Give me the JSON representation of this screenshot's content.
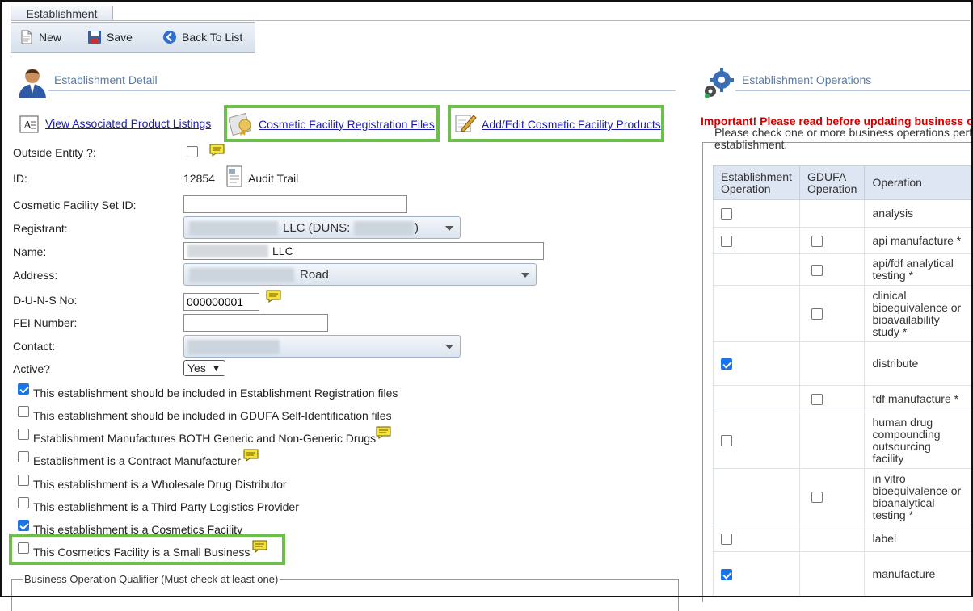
{
  "tab": {
    "label": "Establishment"
  },
  "toolbar": {
    "new_label": "New",
    "save_label": "Save",
    "back_label": "Back To List"
  },
  "detail": {
    "section_title": "Establishment Detail",
    "links": {
      "view_listings": "View Associated Product Listings",
      "registration_files": "Cosmetic Facility Registration Files",
      "add_edit_products": "Add/Edit Cosmetic Facility Products"
    },
    "fields": {
      "outside_entity_label": "Outside Entity ?:",
      "outside_entity_checked": false,
      "id_label": "ID:",
      "id_value": "12854",
      "audit_trail": "Audit Trail",
      "set_id_label": "Cosmetic Facility Set ID:",
      "set_id_value": "",
      "registrant_label": "Registrant:",
      "registrant_value_a": "LLC (DUNS:",
      "registrant_value_b": ")",
      "name_label": "Name:",
      "name_value": "LLC",
      "address_label": "Address:",
      "address_value": "Road",
      "duns_label": "D-U-N-S No:",
      "duns_value": "000000001",
      "fei_label": "FEI Number:",
      "fei_value": "",
      "contact_label": "Contact:",
      "active_label": "Active?",
      "active_value": "Yes"
    },
    "checks": [
      {
        "label": "This establishment should be included in Establishment Registration files",
        "checked": true
      },
      {
        "label": "This establishment should be included in GDUFA Self-Identification files",
        "checked": false
      },
      {
        "label": "Establishment Manufactures BOTH Generic and Non-Generic Drugs",
        "checked": false
      },
      {
        "label": "Establishment is a Contract Manufacturer",
        "checked": false
      },
      {
        "label": "This establishment is a Wholesale Drug Distributor",
        "checked": false
      },
      {
        "label": "This establishment is a Third Party Logistics Provider",
        "checked": false
      },
      {
        "label": "This establishment is a Cosmetics Facility",
        "checked": true
      },
      {
        "label": "This Cosmetics Facility is a Small Business",
        "checked": false
      }
    ],
    "qualifier_legend": "Business Operation Qualifier (Must check at least one)"
  },
  "operations": {
    "section_title": "Establishment Operations",
    "warning": "Important! Please read before updating business op",
    "instruction_line1": "Please check one or more business operations perfo",
    "instruction_line2": "establishment.",
    "headers": {
      "est_line1": "Establishment",
      "est_line2": "Operation",
      "gdufa_line1": "GDUFA",
      "gdufa_line2": "Operation",
      "op": "Operation"
    },
    "rows": [
      {
        "est": "unchecked",
        "gdufa": "none",
        "lines": [
          "analysis"
        ]
      },
      {
        "est": "unchecked",
        "gdufa": "unchecked",
        "lines": [
          "api manufacture *"
        ]
      },
      {
        "est": "none",
        "gdufa": "unchecked",
        "lines": [
          "api/fdf analytical",
          "testing *"
        ]
      },
      {
        "est": "none",
        "gdufa": "unchecked",
        "lines": [
          "clinical",
          "bioequivalence or",
          "bioavailability",
          "study *"
        ]
      },
      {
        "est": "checked",
        "gdufa": "none",
        "lines": [
          "distribute"
        ]
      },
      {
        "est": "none",
        "gdufa": "unchecked",
        "lines": [
          "fdf manufacture *"
        ]
      },
      {
        "est": "unchecked",
        "gdufa": "none",
        "lines": [
          "human drug",
          "compounding",
          "outsourcing",
          "facility"
        ]
      },
      {
        "est": "none",
        "gdufa": "unchecked",
        "lines": [
          "in vitro",
          "bioequivalence or",
          "bioanalytical",
          "testing *"
        ]
      },
      {
        "est": "unchecked",
        "gdufa": "none",
        "lines": [
          "label"
        ]
      },
      {
        "est": "checked",
        "gdufa": "none",
        "lines": [
          "manufacture"
        ]
      }
    ]
  },
  "colors": {
    "highlight": "#6cc04a",
    "warning": "#d40000",
    "link": "#1a1ab0",
    "header_bg": "#dde6f2",
    "checkbox_on": "#1a73e8"
  }
}
